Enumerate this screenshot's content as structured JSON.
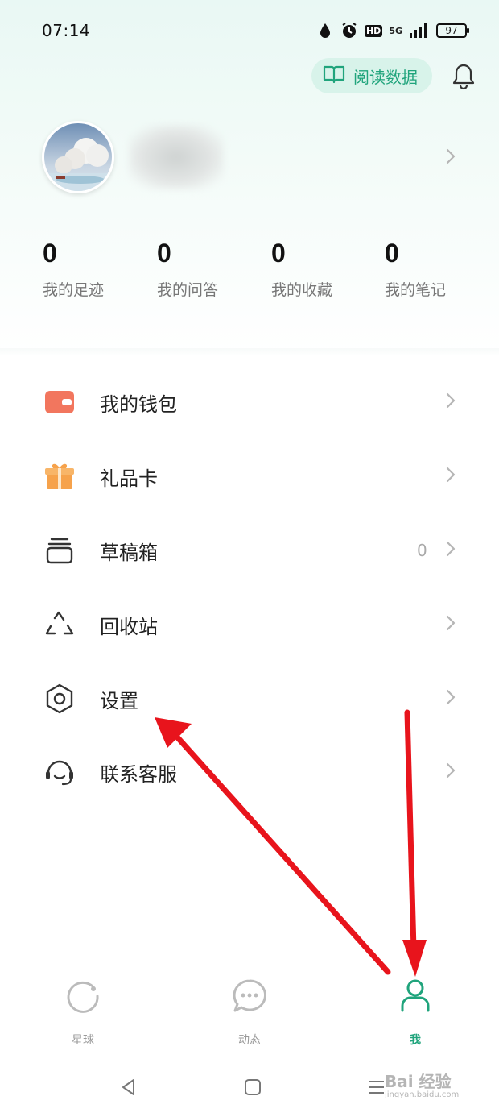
{
  "status_bar": {
    "time": "07:14",
    "network": "5G",
    "hd": "HD",
    "battery": "97"
  },
  "header": {
    "read_data_label": "阅读数据"
  },
  "stats": [
    {
      "value": "0",
      "label": "我的足迹"
    },
    {
      "value": "0",
      "label": "我的问答"
    },
    {
      "value": "0",
      "label": "我的收藏"
    },
    {
      "value": "0",
      "label": "我的笔记"
    }
  ],
  "menu": [
    {
      "label": "我的钱包",
      "icon": "wallet-icon"
    },
    {
      "label": "礼品卡",
      "icon": "gift-icon"
    },
    {
      "label": "草稿箱",
      "icon": "drafts-icon",
      "count": "0"
    },
    {
      "label": "回收站",
      "icon": "recycle-icon"
    },
    {
      "label": "设置",
      "icon": "settings-icon"
    },
    {
      "label": "联系客服",
      "icon": "headset-icon"
    }
  ],
  "tabs": [
    {
      "label": "星球",
      "icon": "planet-icon"
    },
    {
      "label": "动态",
      "icon": "chat-bubble-icon"
    },
    {
      "label": "我",
      "icon": "person-icon",
      "active": true
    }
  ],
  "colors": {
    "accent": "#20a47c",
    "annotation_arrow": "#e8141c",
    "wallet": "#f2765e",
    "gift": "#f6a24b"
  },
  "watermark": {
    "brand": "Bai 经验",
    "url": "jingyan.baidu.com"
  }
}
